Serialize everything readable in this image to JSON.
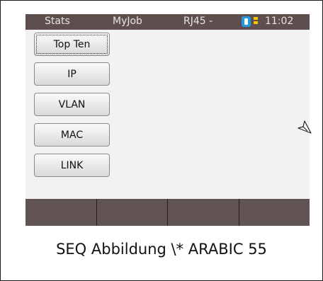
{
  "statusbar": {
    "tab_stats": "Stats",
    "tab_myjob": "MyJob",
    "tab_port": "RJ45 -",
    "clock": "11:02",
    "battery_icon": "battery-icon",
    "network_icon": "network-icon"
  },
  "menu": {
    "items": [
      {
        "label": "Top Ten",
        "focused": true
      },
      {
        "label": "IP"
      },
      {
        "label": "VLAN"
      },
      {
        "label": "MAC"
      },
      {
        "label": "LINK"
      }
    ]
  },
  "softkeys": [
    "",
    "",
    "",
    ""
  ],
  "caption": "SEQ Abbildung \\* ARABIC 55",
  "colors": {
    "statusbar_bg": "#5e4f4e",
    "softkey_bg": "#615253",
    "screen_bg": "#f2f2f2",
    "battery": "#2299dd",
    "network": "#f5c400"
  }
}
